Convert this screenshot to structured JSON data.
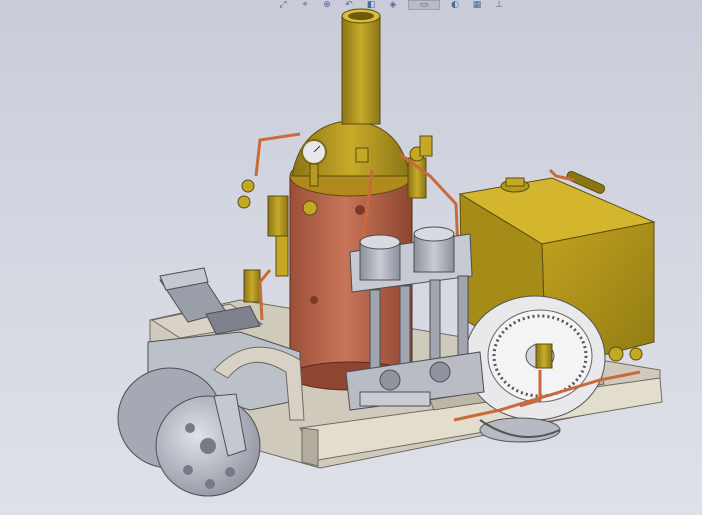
{
  "window": {
    "background_top": "#c9ccd8",
    "background_bottom": "#dfe1e8"
  },
  "toolbar": {
    "items": [
      {
        "name": "view-orientation-icon",
        "glyph": "⤢"
      },
      {
        "name": "zoom-fit-icon",
        "glyph": "⌖"
      },
      {
        "name": "zoom-area-icon",
        "glyph": "⊕"
      },
      {
        "name": "previous-view-icon",
        "glyph": "↶"
      },
      {
        "name": "section-view-icon",
        "glyph": "◧"
      },
      {
        "name": "display-style-icon",
        "glyph": "◈"
      },
      {
        "name": "view-selector-icon",
        "glyph": "▭"
      },
      {
        "name": "hide-show-icon",
        "glyph": "◐"
      },
      {
        "name": "appearance-icon",
        "glyph": "▦"
      },
      {
        "name": "scene-icon",
        "glyph": "⊥"
      }
    ]
  },
  "model": {
    "name_hint": "steam-roller-assembly",
    "colors": {
      "boiler_copper": "#b9634a",
      "brass": "#b59a1e",
      "brass_dark": "#8a7416",
      "steel": "#a9adb8",
      "steel_dark": "#6f737d",
      "frame": "#d7d2c4",
      "frame_dark": "#9c978b",
      "pipe": "#c96a3a"
    }
  }
}
